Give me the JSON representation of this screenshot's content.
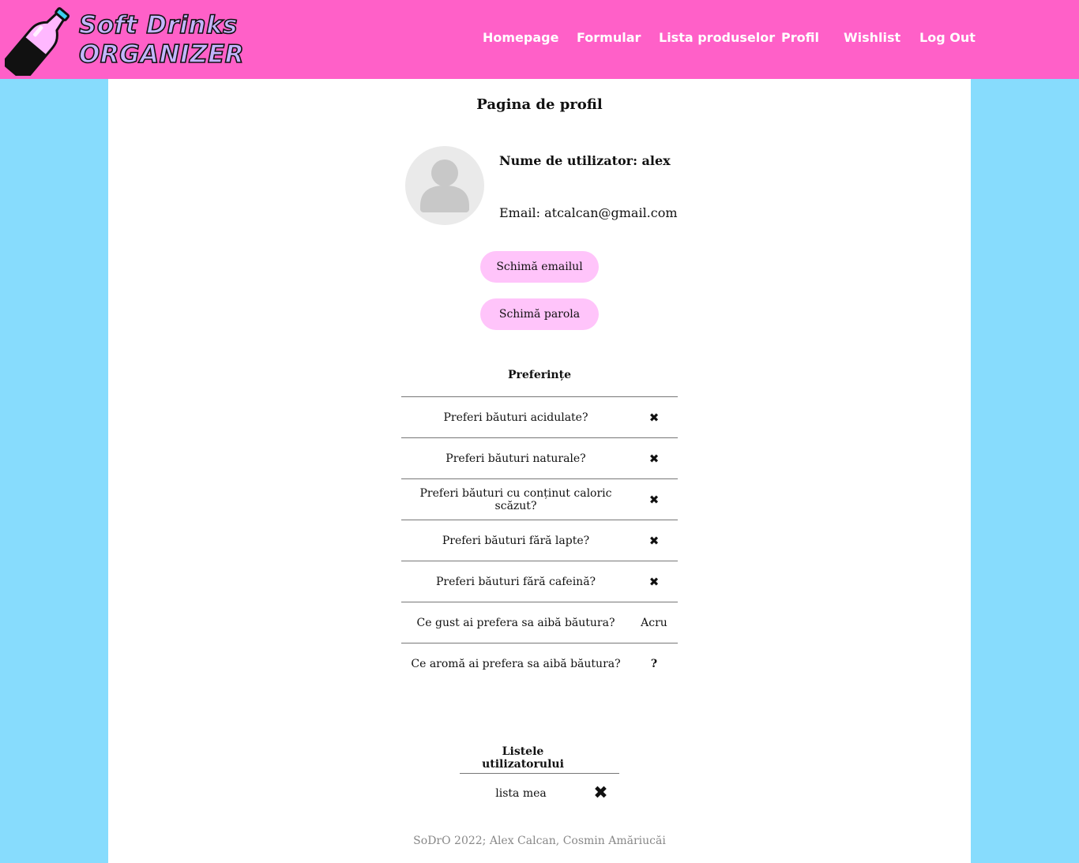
{
  "header": {
    "logo_line1": "Soft Drinks",
    "logo_line2": "ORGANIZER",
    "nav": [
      "Homepage",
      "Formular",
      "Lista produselor",
      "Profil",
      "Wishlist",
      "Log Out"
    ]
  },
  "colors": {
    "header_bg": "#ff60c8",
    "page_bg": "#87dcfd",
    "button_bg": "#ffc4fa",
    "logo_text": "#c3b5ff"
  },
  "profile": {
    "title": "Pagina de profil",
    "username_line": "Nume de utilizator: alex",
    "email_line": "Email: atcalcan@gmail.com",
    "change_email_button": "Schimă emailul",
    "change_password_button": "Schimă parola"
  },
  "preferences": {
    "title": "Preferințe",
    "rows": [
      {
        "question": "Preferi băuturi acidulate?",
        "answer": "✖"
      },
      {
        "question": "Preferi băuturi naturale?",
        "answer": "✖"
      },
      {
        "question": "Preferi băuturi cu conținut caloric scăzut?",
        "answer": "✖"
      },
      {
        "question": "Preferi băuturi fără lapte?",
        "answer": "✖"
      },
      {
        "question": "Preferi băuturi fără cafeină?",
        "answer": "✖"
      },
      {
        "question": "Ce gust ai prefera sa aibă băutura?",
        "answer": "Acru"
      },
      {
        "question": "Ce aromă ai prefera sa aibă băutura?",
        "answer": "?"
      }
    ]
  },
  "lists": {
    "title": "Listele utilizatorului",
    "items": [
      {
        "name": "lista mea",
        "delete_icon": "✖"
      }
    ]
  },
  "footer": {
    "text": "SoDrO 2022; Alex Calcan, Cosmin Amăriucăi"
  }
}
